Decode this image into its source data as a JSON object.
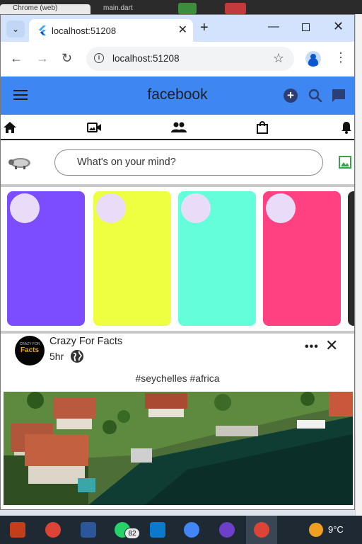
{
  "desktop": {
    "background_tab_label": "Chrome (web)",
    "background_file_label": "main.dart"
  },
  "browser": {
    "tab_title": "localhost:51208",
    "url": "localhost:51208",
    "tab_close": "✕",
    "new_tab": "+",
    "menu_caret": "⌄",
    "back": "←",
    "forward": "→",
    "reload": "↻",
    "star": "☆",
    "more": "⋮",
    "minimize": "—",
    "close": "✕"
  },
  "app": {
    "brand": "facebook",
    "icons": [
      "hamburger-menu-icon",
      "add-circle-icon",
      "search-icon",
      "messenger-icon"
    ],
    "nav_icons": [
      "home-icon",
      "video-icon",
      "people-icon",
      "shopping-bag-icon",
      "notifications-bell-icon"
    ],
    "composer": {
      "placeholder": "What's on your mind?",
      "photo_icon": "photo-icon"
    },
    "stories": [
      {
        "color": "#7c4dff"
      },
      {
        "color": "#eeff41"
      },
      {
        "color": "#64ffda"
      },
      {
        "color": "#ff4081"
      },
      {
        "color": "#2a2a2a"
      }
    ],
    "post": {
      "author": "Crazy For Facts",
      "time": "5hr",
      "avatar_text": "Facts",
      "avatar_small_text": "CRAZY FOR",
      "caption": "#seychelles #africa",
      "more": "•••",
      "close": "✕"
    }
  },
  "taskbar": {
    "apps": [
      "powerpoint-icon",
      "chrome-icon",
      "word-icon",
      "whatsapp-icon",
      "vscode-icon",
      "android-studio-icon",
      "github-desktop-icon",
      "chrome-active-icon"
    ],
    "whatsapp_badge": "82",
    "weather": "9°C"
  }
}
